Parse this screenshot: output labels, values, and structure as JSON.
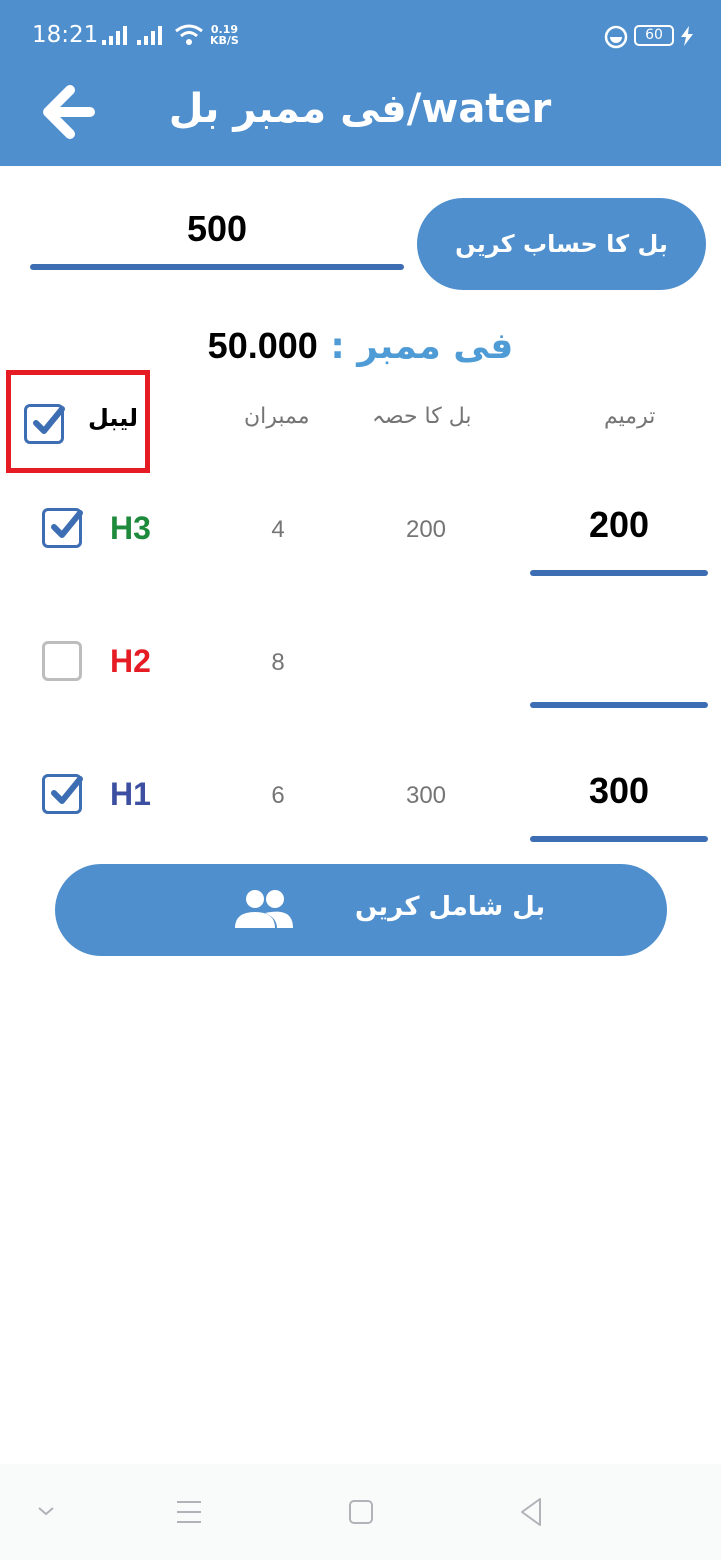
{
  "status_bar": {
    "time": "18:21",
    "speed_value": "0.19",
    "speed_unit": "KB/S",
    "battery": "60"
  },
  "header": {
    "title": "فی ممبر بل/water",
    "back_icon": "arrow-left-icon"
  },
  "total": {
    "value": "500",
    "calculate_button": "بل کا حساب کریں"
  },
  "per_member": {
    "label": "فی ممبر :",
    "value": "50.000"
  },
  "columns": {
    "label": "لیبل",
    "members": "ممبران",
    "share": "بل کا حصہ",
    "adjust": "ترمیم"
  },
  "rows": [
    {
      "name": "H3",
      "color": "#1e8a3c",
      "checked": true,
      "members": "4",
      "share": "200",
      "adjust": "200"
    },
    {
      "name": "H2",
      "color": "#e51c23",
      "checked": false,
      "members": "8",
      "share": "",
      "adjust": ""
    },
    {
      "name": "H1",
      "color": "#3d4fa0",
      "checked": true,
      "members": "6",
      "share": "300",
      "adjust": "300"
    }
  ],
  "add_button": {
    "label": "بل شامل کریں",
    "icon": "people-icon"
  },
  "colors": {
    "accent": "#4f8fcd",
    "underline": "#3d6db3",
    "highlight_box": "#e51c23"
  },
  "navbar": {
    "icons": [
      "chevron-down-icon",
      "menu-icon",
      "home-square-icon",
      "back-triangle-icon"
    ]
  }
}
